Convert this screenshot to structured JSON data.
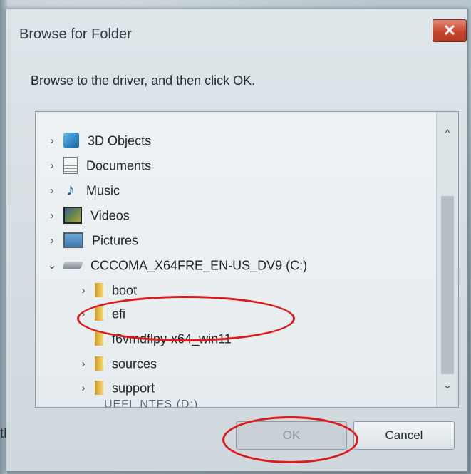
{
  "dialog": {
    "title": "Browse for Folder",
    "close_label": "✕",
    "instruction": "Browse to the driver, and then click OK."
  },
  "tree": {
    "items": [
      {
        "label": "3D Objects",
        "expander": "›",
        "icon": "3d-objects-icon"
      },
      {
        "label": "Documents",
        "expander": "›",
        "icon": "documents-icon"
      },
      {
        "label": "Music",
        "expander": "›",
        "icon": "music-icon"
      },
      {
        "label": "Videos",
        "expander": "›",
        "icon": "videos-icon"
      },
      {
        "label": "Pictures",
        "expander": "›",
        "icon": "pictures-icon"
      },
      {
        "label": "CCCOMA_X64FRE_EN-US_DV9 (C:)",
        "expander": "⌄",
        "icon": "drive-icon",
        "expanded": true
      },
      {
        "label": "boot",
        "expander": "›",
        "icon": "folder-icon"
      },
      {
        "label": "efi",
        "expander": "›",
        "icon": "folder-icon"
      },
      {
        "label": "f6vmdflpy-x64_win11",
        "expander": "",
        "icon": "folder-icon",
        "highlighted": true
      },
      {
        "label": "sources",
        "expander": "›",
        "icon": "folder-icon"
      },
      {
        "label": "support",
        "expander": "›",
        "icon": "folder-icon"
      }
    ],
    "partial_item": "UEFI_NTFS (D:)",
    "scroll_up": "^",
    "scroll_down": "⌄"
  },
  "buttons": {
    "ok": "OK",
    "cancel": "Cancel"
  },
  "background_text": "th",
  "colors": {
    "annotation": "#e01818",
    "close_button": "#c8442c",
    "folder": "#e9bf4a"
  }
}
